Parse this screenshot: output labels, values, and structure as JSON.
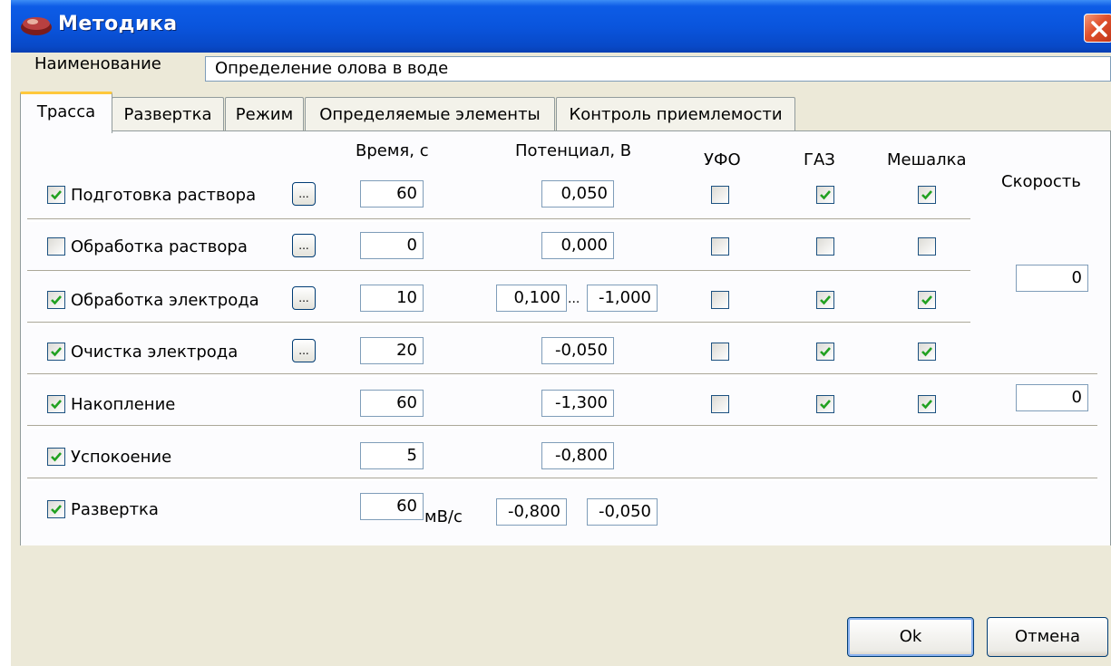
{
  "window": {
    "title": "Методика"
  },
  "name": {
    "label": "Наименование",
    "value": "Определение олова в воде"
  },
  "tabs": [
    {
      "label": "Трасса",
      "active": true
    },
    {
      "label": "Развертка",
      "active": false
    },
    {
      "label": "Режим",
      "active": false
    },
    {
      "label": "Определяемые элементы",
      "active": false
    },
    {
      "label": "Контроль приемлемости",
      "active": false
    }
  ],
  "headers": {
    "time": "Время, с",
    "potential": "Потенциал, В",
    "ufo": "УФО",
    "gas": "ГАЗ",
    "stirrer": "Мешалка",
    "speed": "Скорость"
  },
  "rows": [
    {
      "label": "Подготовка раствора",
      "enabled": true,
      "time": "60",
      "potential": "0,050",
      "ufo": false,
      "gas": true,
      "stirrer": true
    },
    {
      "label": "Обработка раствора",
      "enabled": false,
      "time": "0",
      "potential": "0,000",
      "ufo": false,
      "gas": false,
      "stirrer": false
    },
    {
      "label": "Обработка электрода",
      "enabled": true,
      "time": "10",
      "potential_from": "0,100",
      "range_separator": "...",
      "potential_to": "-1,000",
      "ufo": false,
      "gas": true,
      "stirrer": true
    },
    {
      "label": "Очистка электрода",
      "enabled": true,
      "time": "20",
      "potential": "-0,050",
      "ufo": false,
      "gas": true,
      "stirrer": true
    },
    {
      "label": "Накопление",
      "enabled": true,
      "time": "60",
      "potential": "-1,300",
      "ufo": false,
      "gas": true,
      "stirrer": true
    },
    {
      "label": "Успокоение",
      "enabled": true,
      "time": "5",
      "potential": "-0,800"
    },
    {
      "label": "Развертка",
      "enabled": true,
      "time": "60",
      "time_unit": "мВ/с",
      "potential_from": "-0,800",
      "potential_to": "-0,050"
    }
  ],
  "speed": {
    "value_1": "0",
    "value_2": "0"
  },
  "buttons": {
    "ok": "Ok",
    "cancel": "Отмена"
  },
  "dots_label": "...",
  "colors": {
    "titlebar": "#0a55dd",
    "check": "#21a121",
    "tab_highlight": "#ffc83c"
  }
}
